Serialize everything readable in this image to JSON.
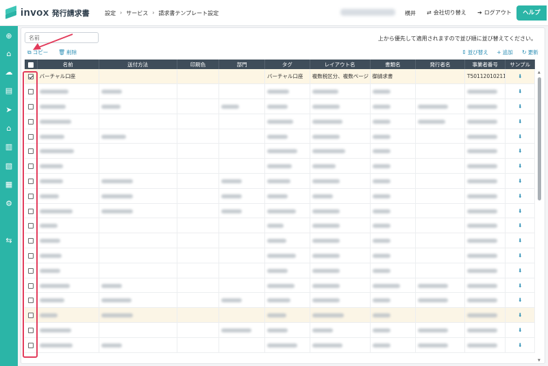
{
  "app": {
    "logo_text": "invox",
    "logo_sub": "発行請求書"
  },
  "breadcrumb": [
    "設定",
    "サービス",
    "請求書テンプレート設定"
  ],
  "header": {
    "user_name": "横井",
    "switch_company": "会社切り替え",
    "logout": "ログアウト",
    "help": "ヘルプ"
  },
  "sidebar": {
    "icons": [
      "plus-circle-icon",
      "home-icon",
      "cloud-upload-icon",
      "document-icon",
      "send-icon",
      "bank-icon",
      "building-icon",
      "document-export-icon",
      "chart-icon",
      "gear-icon",
      "transfer-icon"
    ]
  },
  "toolbar": {
    "search_placeholder": "名前",
    "notice": "上から優先して適用されますので並び順に並び替えてください。",
    "copy": "コピー",
    "delete": "削除",
    "sort": "並び替え",
    "add": "追加",
    "refresh": "更新"
  },
  "table": {
    "columns": [
      "名前",
      "送付方法",
      "印刷色",
      "部門",
      "タグ",
      "レイアウト名",
      "書類名",
      "発行者名",
      "事業者番号",
      "サンプル"
    ],
    "first_row": {
      "name": "バーチャル口座",
      "tag": "バーチャル口座",
      "layout": "複数税区分、複数ページ",
      "doc": "御請求書",
      "reg_no": "T5011201021114"
    }
  },
  "colors": {
    "accent": "#2bb5a7",
    "link": "#2e8fb5",
    "header_dark": "#3f4d5a",
    "annotation": "#e23a5a"
  }
}
